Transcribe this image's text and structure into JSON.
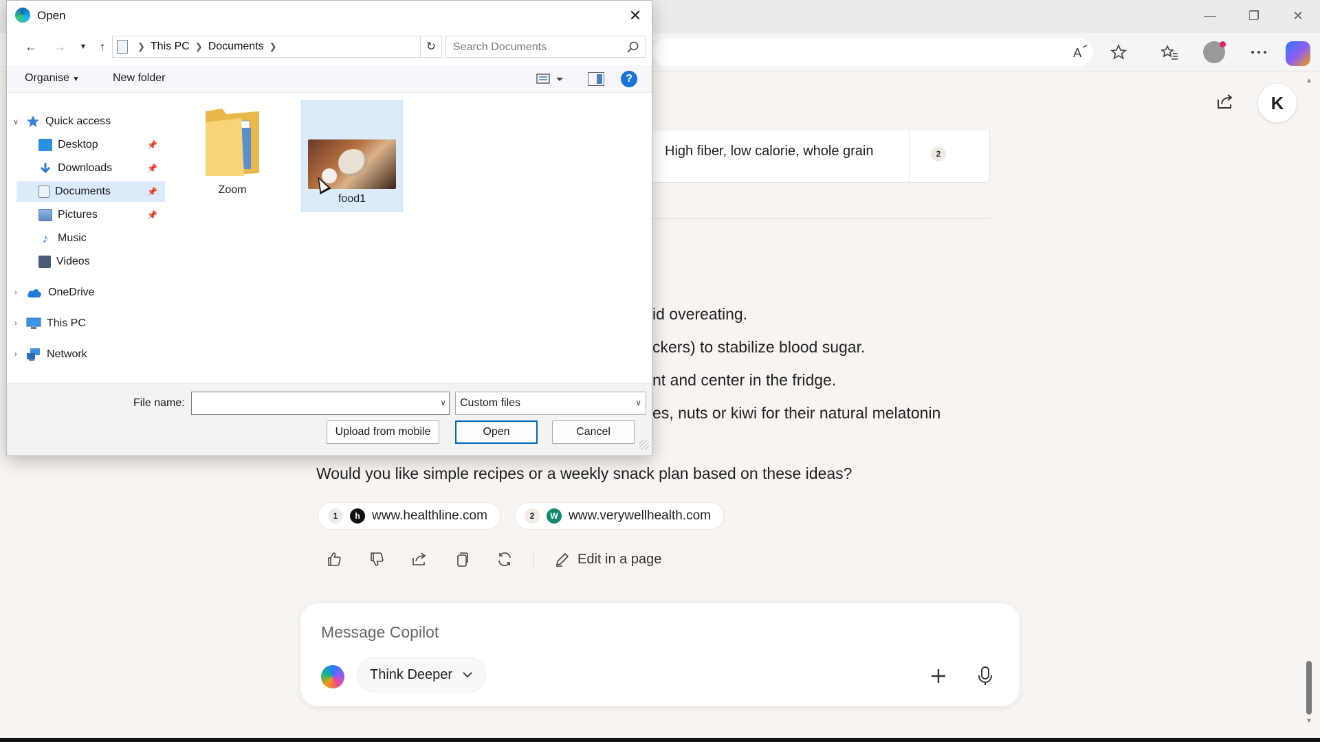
{
  "dialog": {
    "title": "Open",
    "path": [
      "This PC",
      "Documents"
    ],
    "search_placeholder": "Search Documents",
    "commands": {
      "organise": "Organise",
      "new_folder": "New folder"
    },
    "nav": {
      "quick_access": "Quick access",
      "quick_items": [
        {
          "label": "Desktop",
          "icon": "desktop-icon",
          "pinned": true
        },
        {
          "label": "Downloads",
          "icon": "downloads-icon",
          "pinned": true
        },
        {
          "label": "Documents",
          "icon": "documents-icon",
          "pinned": true,
          "selected": true
        },
        {
          "label": "Pictures",
          "icon": "pictures-icon",
          "pinned": true
        },
        {
          "label": "Music",
          "icon": "music-icon",
          "pinned": false
        },
        {
          "label": "Videos",
          "icon": "videos-icon",
          "pinned": false
        }
      ],
      "roots": [
        {
          "label": "OneDrive",
          "icon": "onedrive-icon"
        },
        {
          "label": "This PC",
          "icon": "this-pc-icon"
        },
        {
          "label": "Network",
          "icon": "network-icon"
        }
      ]
    },
    "files": [
      {
        "name": "Zoom",
        "kind": "folder"
      },
      {
        "name": "food1",
        "kind": "image",
        "selected": true
      }
    ],
    "file_name_label": "File name:",
    "file_name_value": "",
    "file_type": "Custom files",
    "buttons": {
      "upload": "Upload from mobile",
      "open": "Open",
      "cancel": "Cancel"
    }
  },
  "copilot": {
    "avatar_initial": "K",
    "table_row": {
      "text": "High fiber, low calorie, whole grain",
      "citation": "2"
    },
    "body_lines": [
      "id overeating.",
      "ckers) to stabilize blood sugar.",
      "nt and center in the fridge.",
      "es, nuts or kiwi for their natural melatonin"
    ],
    "question": "Would you like simple recipes or a weekly snack plan based on these ideas?",
    "citations": [
      {
        "num": "1",
        "site": "www.healthline.com",
        "logo_letter": "h",
        "logo_color": "#111111"
      },
      {
        "num": "2",
        "site": "www.verywellhealth.com",
        "logo_letter": "W",
        "logo_color": "#0f8a6a"
      }
    ],
    "edit_in_page": "Edit in a page",
    "composer": {
      "placeholder": "Message Copilot",
      "mode": "Think Deeper"
    }
  },
  "colors": {
    "accent": "#0067c0",
    "selection": "#dcebfa",
    "page_bg": "#f7f4f1"
  }
}
